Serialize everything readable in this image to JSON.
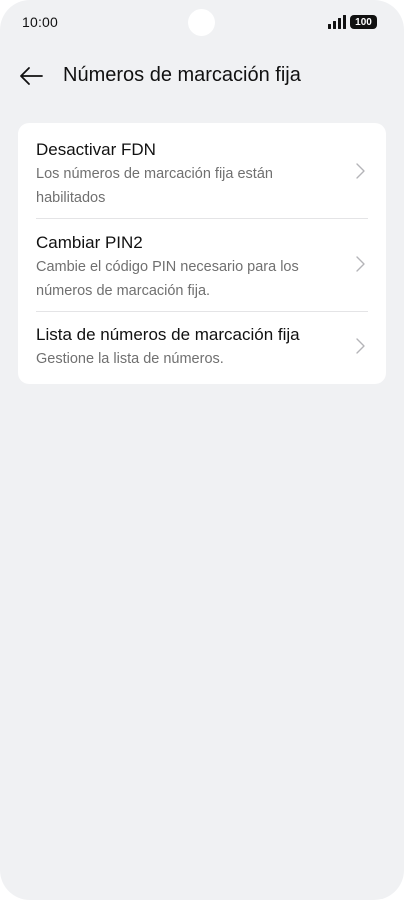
{
  "status_bar": {
    "time": "10:00",
    "battery": "100",
    "signal_icon": "signal-bars-icon"
  },
  "header": {
    "back_icon": "arrow-left-icon",
    "title": "Números de marcación fija"
  },
  "items": [
    {
      "title": "Desactivar FDN",
      "subtitle": "Los números de marcación fija están habilitados",
      "icon": "chevron-right-icon"
    },
    {
      "title": "Cambiar PIN2",
      "subtitle": "Cambie el código PIN necesario para los números de marcación fija.",
      "icon": "chevron-right-icon"
    },
    {
      "title": "Lista de números de marcación fija",
      "subtitle": "Gestione la lista de números.",
      "icon": "chevron-right-icon"
    }
  ],
  "colors": {
    "background": "#f0f1f3",
    "card": "#ffffff",
    "text_primary": "#111111",
    "text_secondary": "#707070"
  }
}
